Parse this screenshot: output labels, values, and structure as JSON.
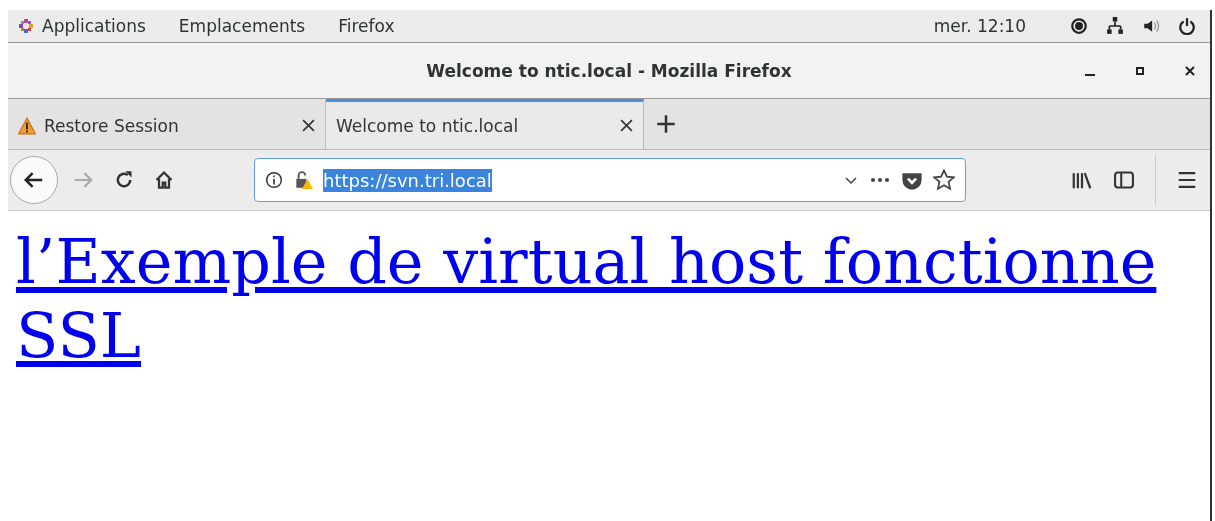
{
  "top_bar": {
    "menus": [
      "Applications",
      "Emplacements",
      "Firefox"
    ],
    "clock": "mer. 12:10"
  },
  "window": {
    "title": "Welcome to ntic.local - Mozilla Firefox"
  },
  "tabs": [
    {
      "label": "Restore Session",
      "kind": "warning",
      "selected": false
    },
    {
      "label": "Welcome to ntic.local",
      "kind": "page",
      "selected": true
    }
  ],
  "nav": {
    "back_disabled": false,
    "forward_disabled": true
  },
  "url": {
    "value": "https://svn.tri.local",
    "selected": true
  },
  "page": {
    "link": "l’Exemple de virtual host fonctionne SSL"
  }
}
